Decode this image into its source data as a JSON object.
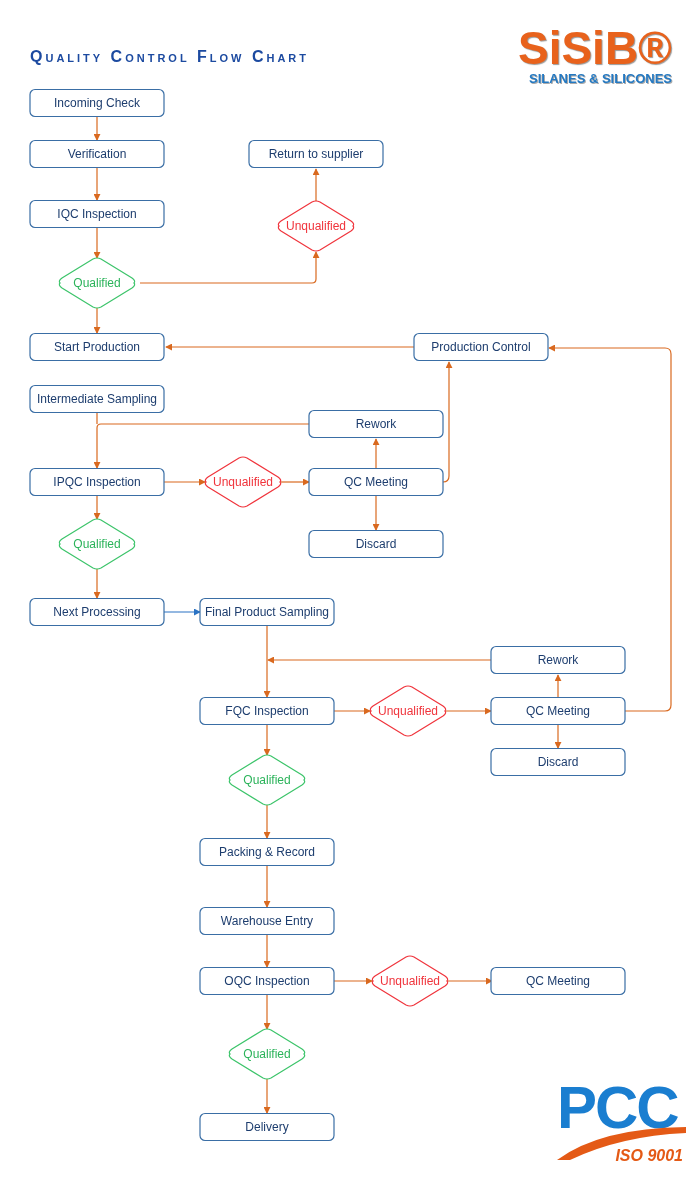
{
  "title": "Quality Control Flow Chart",
  "brand_logo": {
    "name": "SiSiB®",
    "tagline": "SILANES & SILICONES"
  },
  "certification_logo": {
    "name": "PCC",
    "standard": "ISO 9001"
  },
  "flowchart": {
    "nodes": [
      {
        "kind": "step",
        "label": "Incoming Check"
      },
      {
        "kind": "step",
        "label": "Verification"
      },
      {
        "kind": "step",
        "label": "Return to supplier"
      },
      {
        "kind": "fail",
        "label": "Unqualified"
      },
      {
        "kind": "step",
        "label": "IQC Inspection"
      },
      {
        "kind": "pass",
        "label": "Qualified"
      },
      {
        "kind": "step",
        "label": "Start Production"
      },
      {
        "kind": "step",
        "label": "Production Control"
      },
      {
        "kind": "step",
        "label": "Intermediate Sampling"
      },
      {
        "kind": "step",
        "label": "Rework"
      },
      {
        "kind": "step",
        "label": "IPQC Inspection"
      },
      {
        "kind": "fail",
        "label": "Unqualified"
      },
      {
        "kind": "step",
        "label": "QC Meeting"
      },
      {
        "kind": "pass",
        "label": "Qualified"
      },
      {
        "kind": "step",
        "label": "Discard"
      },
      {
        "kind": "step",
        "label": "Next Processing"
      },
      {
        "kind": "step",
        "label": "Final Product Sampling"
      },
      {
        "kind": "step",
        "label": "Rework"
      },
      {
        "kind": "step",
        "label": "FQC Inspection"
      },
      {
        "kind": "fail",
        "label": "Unqualified"
      },
      {
        "kind": "step",
        "label": "QC Meeting"
      },
      {
        "kind": "pass",
        "label": "Qualified"
      },
      {
        "kind": "step",
        "label": "Discard"
      },
      {
        "kind": "step",
        "label": "Packing & Record"
      },
      {
        "kind": "step",
        "label": "Warehouse Entry"
      },
      {
        "kind": "step",
        "label": "OQC Inspection"
      },
      {
        "kind": "fail",
        "label": "Unqualified"
      },
      {
        "kind": "step",
        "label": "QC Meeting"
      },
      {
        "kind": "pass",
        "label": "Qualified"
      },
      {
        "kind": "step",
        "label": "Delivery"
      }
    ]
  }
}
